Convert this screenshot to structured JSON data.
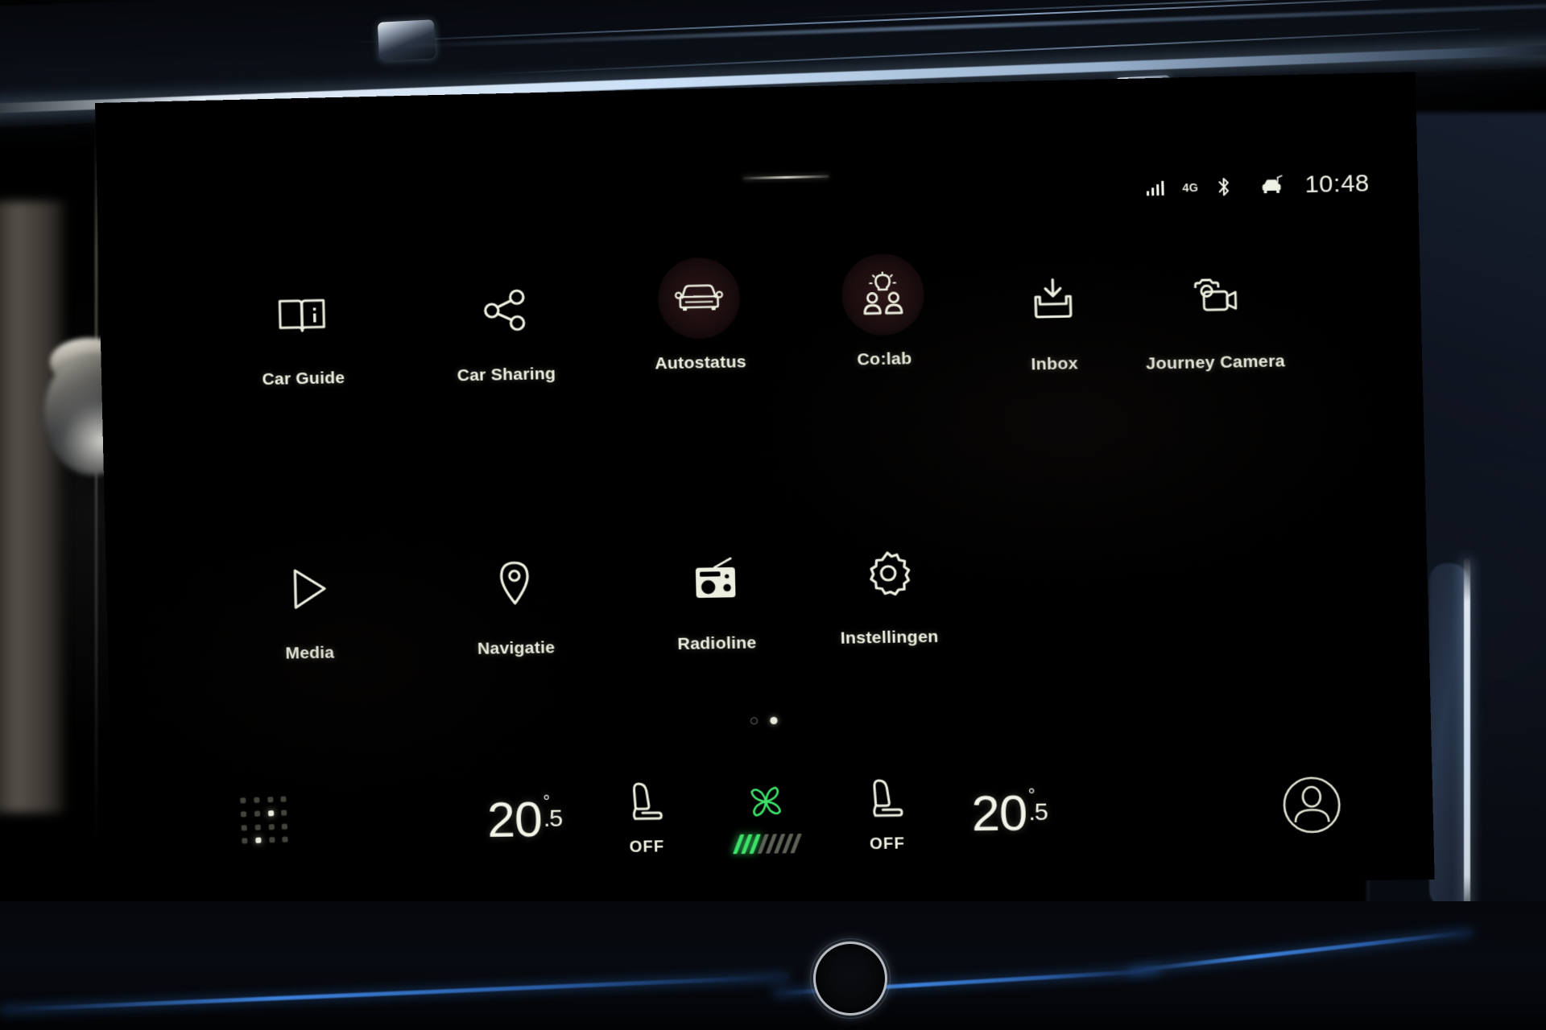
{
  "device": {
    "kind": "car-infotainment-touchscreen",
    "language": "nl"
  },
  "statusbar": {
    "signal_icon": "signal-bars-icon",
    "signal_bars_total": 4,
    "signal_bars_active": 4,
    "network_label": "4G",
    "bluetooth_icon": "bluetooth-icon",
    "car_connected_icon": "car-antenna-icon",
    "clock": "10:48"
  },
  "home": {
    "pull_handle": "pull-down-handle",
    "apps": [
      {
        "label": "Car Guide",
        "icon": "book-info-icon",
        "circled": false
      },
      {
        "label": "Car Sharing",
        "icon": "share-nodes-icon",
        "circled": false
      },
      {
        "label": "Autostatus",
        "icon": "car-front-icon",
        "circled": true
      },
      {
        "label": "Co:lab",
        "icon": "lightbulb-people-icon",
        "circled": true
      },
      {
        "label": "Inbox",
        "icon": "inbox-tray-icon",
        "circled": false
      },
      {
        "label": "Journey Camera",
        "icon": "video-camera-icon",
        "circled": false
      },
      {
        "label": "Media",
        "icon": "play-triangle-icon",
        "circled": false
      },
      {
        "label": "Navigatie",
        "icon": "map-pin-icon",
        "circled": false
      },
      {
        "label": "Radioline",
        "icon": "radio-icon",
        "circled": false
      },
      {
        "label": "Instellingen",
        "icon": "gear-icon",
        "circled": false
      }
    ],
    "pagination": {
      "total": 2,
      "current": 2
    },
    "app_drawer_icon": "dot-matrix-grid-icon"
  },
  "climate": {
    "left_temperature": {
      "whole": "20",
      "degree": "°",
      "fraction": ".5"
    },
    "left_seat": {
      "icon": "car-seat-icon",
      "state": "OFF"
    },
    "fan": {
      "icon": "fan-blades-icon",
      "bars_total": 8,
      "bars_active": 3,
      "active_color": "#3ee06a",
      "inactive_color": "#5c6156"
    },
    "right_seat": {
      "icon": "car-seat-icon",
      "state": "OFF"
    },
    "right_temperature": {
      "whole": "20",
      "degree": "°",
      "fraction": ".5"
    },
    "profile_icon": "user-avatar-icon"
  },
  "colors": {
    "screen_background": "#000000",
    "icon_stroke": "#eceedf",
    "text": "#eceedf",
    "fan_accent": "#3ee06a",
    "tile_circle": "#2e1618",
    "ambient_light": "#468cff"
  }
}
